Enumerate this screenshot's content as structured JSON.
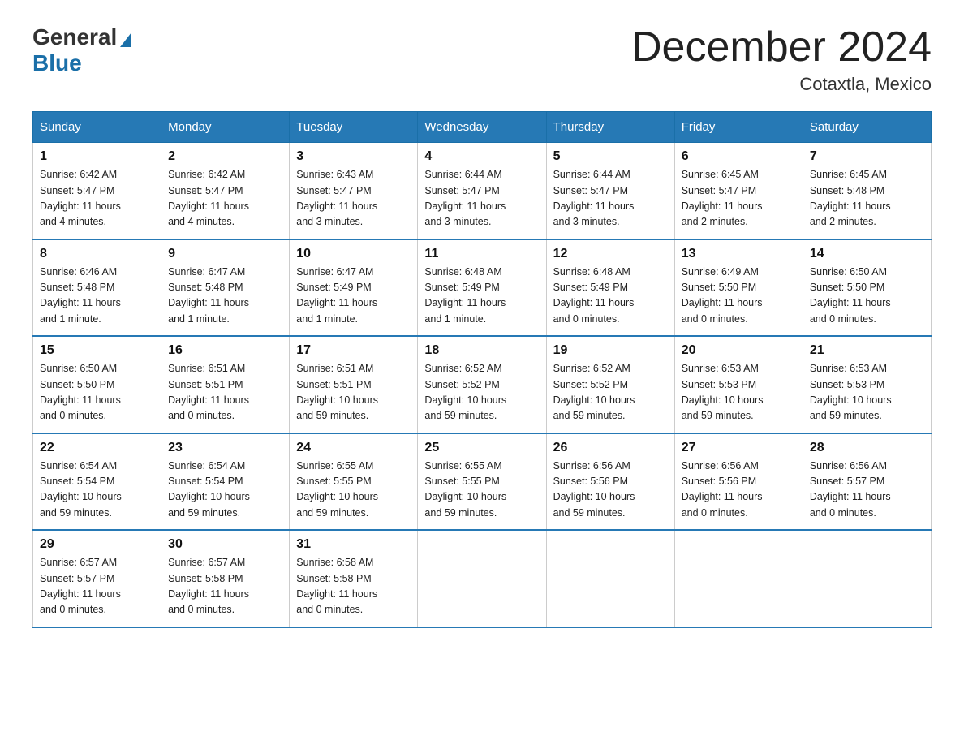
{
  "header": {
    "logo_general": "General",
    "logo_blue": "Blue",
    "month_title": "December 2024",
    "location": "Cotaxtla, Mexico"
  },
  "days_of_week": [
    "Sunday",
    "Monday",
    "Tuesday",
    "Wednesday",
    "Thursday",
    "Friday",
    "Saturday"
  ],
  "weeks": [
    [
      {
        "day": "1",
        "info": "Sunrise: 6:42 AM\nSunset: 5:47 PM\nDaylight: 11 hours\nand 4 minutes."
      },
      {
        "day": "2",
        "info": "Sunrise: 6:42 AM\nSunset: 5:47 PM\nDaylight: 11 hours\nand 4 minutes."
      },
      {
        "day": "3",
        "info": "Sunrise: 6:43 AM\nSunset: 5:47 PM\nDaylight: 11 hours\nand 3 minutes."
      },
      {
        "day": "4",
        "info": "Sunrise: 6:44 AM\nSunset: 5:47 PM\nDaylight: 11 hours\nand 3 minutes."
      },
      {
        "day": "5",
        "info": "Sunrise: 6:44 AM\nSunset: 5:47 PM\nDaylight: 11 hours\nand 3 minutes."
      },
      {
        "day": "6",
        "info": "Sunrise: 6:45 AM\nSunset: 5:47 PM\nDaylight: 11 hours\nand 2 minutes."
      },
      {
        "day": "7",
        "info": "Sunrise: 6:45 AM\nSunset: 5:48 PM\nDaylight: 11 hours\nand 2 minutes."
      }
    ],
    [
      {
        "day": "8",
        "info": "Sunrise: 6:46 AM\nSunset: 5:48 PM\nDaylight: 11 hours\nand 1 minute."
      },
      {
        "day": "9",
        "info": "Sunrise: 6:47 AM\nSunset: 5:48 PM\nDaylight: 11 hours\nand 1 minute."
      },
      {
        "day": "10",
        "info": "Sunrise: 6:47 AM\nSunset: 5:49 PM\nDaylight: 11 hours\nand 1 minute."
      },
      {
        "day": "11",
        "info": "Sunrise: 6:48 AM\nSunset: 5:49 PM\nDaylight: 11 hours\nand 1 minute."
      },
      {
        "day": "12",
        "info": "Sunrise: 6:48 AM\nSunset: 5:49 PM\nDaylight: 11 hours\nand 0 minutes."
      },
      {
        "day": "13",
        "info": "Sunrise: 6:49 AM\nSunset: 5:50 PM\nDaylight: 11 hours\nand 0 minutes."
      },
      {
        "day": "14",
        "info": "Sunrise: 6:50 AM\nSunset: 5:50 PM\nDaylight: 11 hours\nand 0 minutes."
      }
    ],
    [
      {
        "day": "15",
        "info": "Sunrise: 6:50 AM\nSunset: 5:50 PM\nDaylight: 11 hours\nand 0 minutes."
      },
      {
        "day": "16",
        "info": "Sunrise: 6:51 AM\nSunset: 5:51 PM\nDaylight: 11 hours\nand 0 minutes."
      },
      {
        "day": "17",
        "info": "Sunrise: 6:51 AM\nSunset: 5:51 PM\nDaylight: 10 hours\nand 59 minutes."
      },
      {
        "day": "18",
        "info": "Sunrise: 6:52 AM\nSunset: 5:52 PM\nDaylight: 10 hours\nand 59 minutes."
      },
      {
        "day": "19",
        "info": "Sunrise: 6:52 AM\nSunset: 5:52 PM\nDaylight: 10 hours\nand 59 minutes."
      },
      {
        "day": "20",
        "info": "Sunrise: 6:53 AM\nSunset: 5:53 PM\nDaylight: 10 hours\nand 59 minutes."
      },
      {
        "day": "21",
        "info": "Sunrise: 6:53 AM\nSunset: 5:53 PM\nDaylight: 10 hours\nand 59 minutes."
      }
    ],
    [
      {
        "day": "22",
        "info": "Sunrise: 6:54 AM\nSunset: 5:54 PM\nDaylight: 10 hours\nand 59 minutes."
      },
      {
        "day": "23",
        "info": "Sunrise: 6:54 AM\nSunset: 5:54 PM\nDaylight: 10 hours\nand 59 minutes."
      },
      {
        "day": "24",
        "info": "Sunrise: 6:55 AM\nSunset: 5:55 PM\nDaylight: 10 hours\nand 59 minutes."
      },
      {
        "day": "25",
        "info": "Sunrise: 6:55 AM\nSunset: 5:55 PM\nDaylight: 10 hours\nand 59 minutes."
      },
      {
        "day": "26",
        "info": "Sunrise: 6:56 AM\nSunset: 5:56 PM\nDaylight: 10 hours\nand 59 minutes."
      },
      {
        "day": "27",
        "info": "Sunrise: 6:56 AM\nSunset: 5:56 PM\nDaylight: 11 hours\nand 0 minutes."
      },
      {
        "day": "28",
        "info": "Sunrise: 6:56 AM\nSunset: 5:57 PM\nDaylight: 11 hours\nand 0 minutes."
      }
    ],
    [
      {
        "day": "29",
        "info": "Sunrise: 6:57 AM\nSunset: 5:57 PM\nDaylight: 11 hours\nand 0 minutes."
      },
      {
        "day": "30",
        "info": "Sunrise: 6:57 AM\nSunset: 5:58 PM\nDaylight: 11 hours\nand 0 minutes."
      },
      {
        "day": "31",
        "info": "Sunrise: 6:58 AM\nSunset: 5:58 PM\nDaylight: 11 hours\nand 0 minutes."
      },
      {
        "day": "",
        "info": ""
      },
      {
        "day": "",
        "info": ""
      },
      {
        "day": "",
        "info": ""
      },
      {
        "day": "",
        "info": ""
      }
    ]
  ]
}
